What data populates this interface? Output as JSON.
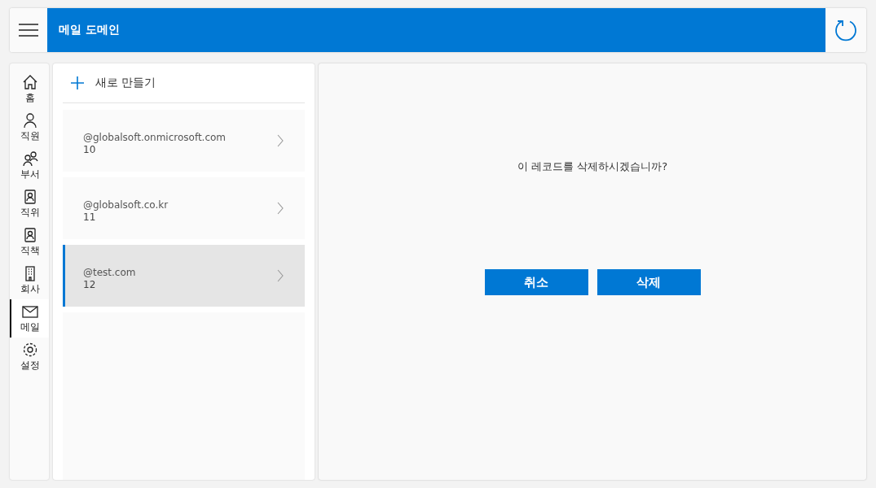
{
  "header": {
    "title": "메일 도메인"
  },
  "nav": [
    {
      "kind": "home",
      "label": "홈",
      "selected": false
    },
    {
      "kind": "person",
      "label": "직원",
      "selected": false
    },
    {
      "kind": "people",
      "label": "부서",
      "selected": false
    },
    {
      "kind": "badge",
      "label": "직위",
      "selected": false
    },
    {
      "kind": "badge",
      "label": "직책",
      "selected": false
    },
    {
      "kind": "building",
      "label": "회사",
      "selected": false
    },
    {
      "kind": "mail",
      "label": "메일",
      "selected": true
    },
    {
      "kind": "gear",
      "label": "설정",
      "selected": false
    }
  ],
  "list": {
    "new_label": "새로 만들기",
    "items": [
      {
        "domain": "@globalsoft.onmicrosoft.com",
        "count": "10",
        "selected": false
      },
      {
        "domain": "@globalsoft.co.kr",
        "count": "11",
        "selected": false
      },
      {
        "domain": "@test.com",
        "count": "12",
        "selected": true
      }
    ]
  },
  "dialog": {
    "message": "이 레코드를 삭제하시겠습니까?",
    "buttons": [
      "취소",
      "삭제"
    ]
  }
}
